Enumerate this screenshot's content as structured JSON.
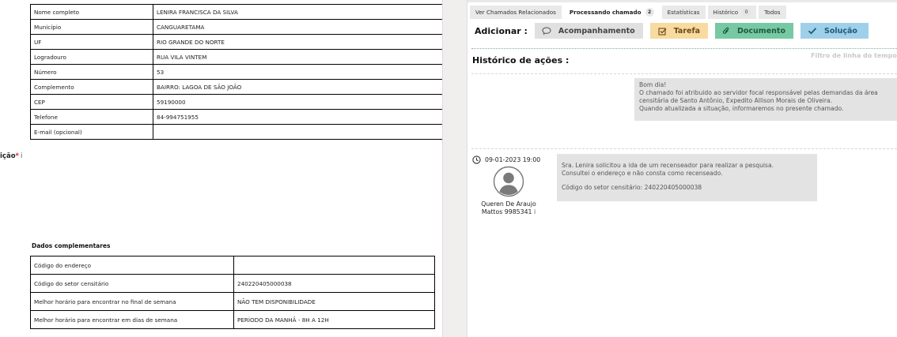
{
  "left": {
    "edge_label": "ição",
    "edge_required_mark": "*",
    "edge_info_mark": "i",
    "ticket_rows": [
      {
        "label": "Nome completo",
        "value": "LENIRA FRANCISCA DA SILVA"
      },
      {
        "label": "Município",
        "value": "CANGUARETAMA"
      },
      {
        "label": "UF",
        "value": "RIO GRANDE DO NORTE"
      },
      {
        "label": "Logradouro",
        "value": "RUA VILA VINTEM"
      },
      {
        "label": "Número",
        "value": "53"
      },
      {
        "label": "Complemento",
        "value": "BAIRRO: LAGOA DE SÃO JOÃO"
      },
      {
        "label": "CEP",
        "value": "59190000"
      },
      {
        "label": "Telefone",
        "value": "84-994751955"
      },
      {
        "label": "E-mail (opcional)",
        "value": ""
      }
    ],
    "complementary_title": "Dados complementares",
    "complementary_rows": [
      {
        "label": "Código do endereço",
        "value": ""
      },
      {
        "label": "Código do setor censitário",
        "value": "240220405000038"
      },
      {
        "label": "Melhor horário para encontrar no final de semana",
        "value": "NÃO TEM DISPONIBILIDADE"
      },
      {
        "label": "Melhor horário para encontrar em dias de semana",
        "value": "PERÍODO DA MANHÃ - 8H A 12H"
      }
    ]
  },
  "right": {
    "tabs": [
      {
        "label": "Ver Chamados Relacionados",
        "badge": null,
        "active": false
      },
      {
        "label": "Processando chamado",
        "badge": "2",
        "active": true
      },
      {
        "label": "Estatísticas",
        "badge": null,
        "active": false
      },
      {
        "label": "Histórico",
        "badge": "0",
        "active": false
      },
      {
        "label": "Todos",
        "badge": null,
        "active": false
      }
    ],
    "add_label": "Adicionar :",
    "actions": {
      "followup": "Acompanhamento",
      "task": "Tarefa",
      "document": "Documento",
      "solution": "Solução"
    },
    "history_title": "Histórico de ações :",
    "filter_link": "Filtro de linha do tempo",
    "first_message": {
      "lines": [
        "Bom dia!",
        "O chamado foi atribuido ao servidor focal responsável pelas demandas da área",
        "censitária de Santo Antônio, Expedito Allison Morais de Oliveira.",
        "Quando atualizada a situação, informaremos no presente chamado."
      ]
    },
    "followup": {
      "date": "09-01-2023 19:00",
      "author_line1": "Queren De Araujo",
      "author_line2": "Mattos 9985341",
      "author_info": "i",
      "lines": [
        "Sra. Lenira solicitou a ida de um recenseador para realizar a pesquisa.",
        "Consultei o endereço e não consta como recenseado."
      ],
      "footer": "Código do setor censitário: 240220405000038"
    }
  },
  "colors": {
    "followup_bg": "#e0e0e0",
    "task_bg": "#f7dba0",
    "document_bg": "#77c9a3",
    "solution_bg": "#9fd0ea",
    "bubble_bg": "#e3e3e3",
    "required": "#e02020"
  },
  "icons": {
    "followup": "speech-bubble-icon",
    "task": "checkbox-icon",
    "document": "paperclip-icon",
    "solution": "checkmark-icon",
    "date": "clock-icon",
    "author": "avatar-icon"
  }
}
